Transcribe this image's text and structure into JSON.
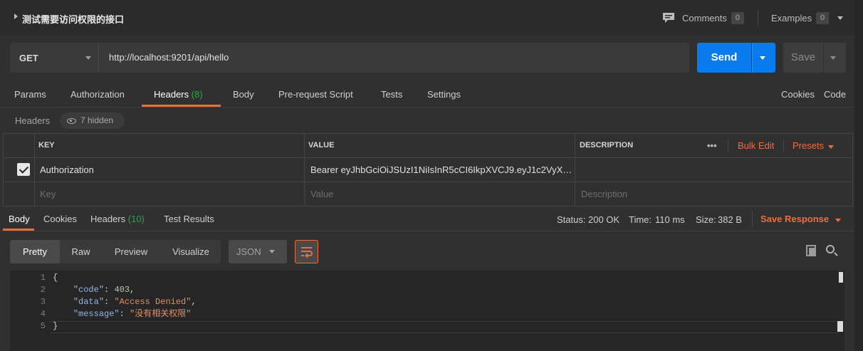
{
  "request": {
    "title": "测试需要访问权限的接口",
    "comments_label": "Comments",
    "comments_count": "0",
    "examples_label": "Examples",
    "examples_count": "0",
    "method": "GET",
    "url": "http://localhost:9201/api/hello",
    "send_label": "Send",
    "save_label": "Save"
  },
  "req_tabs": {
    "params": "Params",
    "authorization": "Authorization",
    "headers": "Headers",
    "headers_count": "(8)",
    "body": "Body",
    "prerequest": "Pre-request Script",
    "tests": "Tests",
    "settings": "Settings",
    "cookies": "Cookies",
    "code": "Code"
  },
  "headers_panel": {
    "label": "Headers",
    "hidden_label": "7 hidden",
    "col_key": "KEY",
    "col_value": "VALUE",
    "col_description": "DESCRIPTION",
    "more": "•••",
    "bulk_edit": "Bulk Edit",
    "presets": "Presets",
    "rows": [
      {
        "checked": true,
        "key": "Authorization",
        "value": "Bearer eyJhbGciOiJSUzI1NiIsInR5cCI6IkpXVCJ9.eyJ1c2VyX2...",
        "description": ""
      }
    ],
    "placeholders": {
      "key": "Key",
      "value": "Value",
      "description": "Description"
    }
  },
  "response": {
    "tabs": {
      "body": "Body",
      "cookies": "Cookies",
      "headers": "Headers",
      "headers_count": "(10)",
      "test_results": "Test Results"
    },
    "status_label": "Status:",
    "status_value": "200 OK",
    "time_label": "Time:",
    "time_value": "110 ms",
    "size_label": "Size:",
    "size_value": "382 B",
    "save_response": "Save Response",
    "views": {
      "pretty": "Pretty",
      "raw": "Raw",
      "preview": "Preview",
      "visualize": "Visualize"
    },
    "format": "JSON",
    "line_numbers": [
      "1",
      "2",
      "3",
      "4",
      "5"
    ],
    "body_lines": {
      "l1": "{",
      "code_key": "\"code\"",
      "code_val": "403",
      "data_key": "\"data\"",
      "data_val": "\"Access Denied\"",
      "message_key": "\"message\"",
      "message_val": "\"没有相关权限\"",
      "l5": "}"
    }
  },
  "colors": {
    "accent": "#f26b3a",
    "send": "#097bed",
    "success": "#28a745"
  }
}
